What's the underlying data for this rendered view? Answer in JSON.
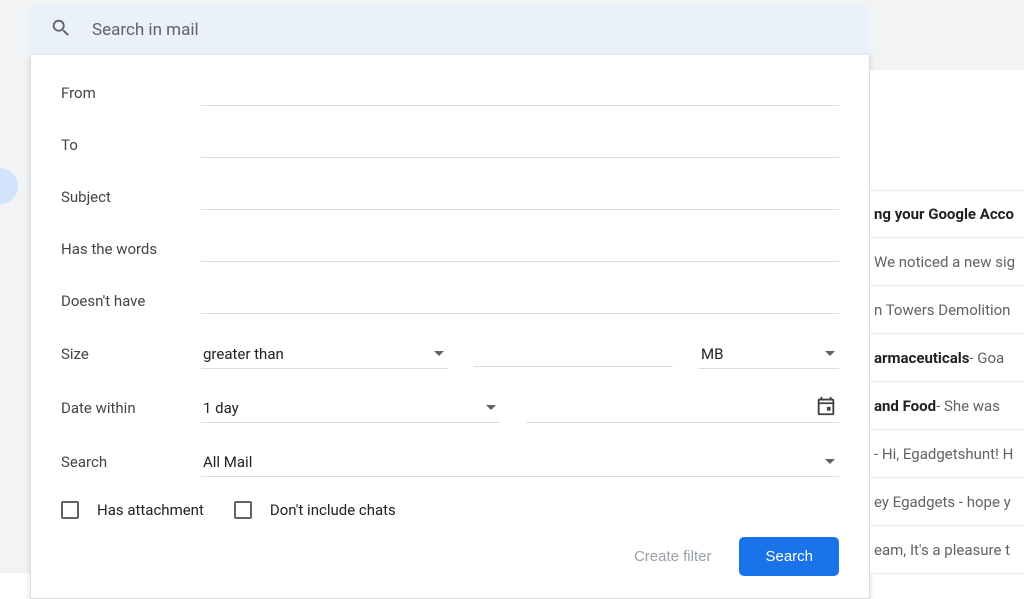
{
  "search": {
    "placeholder": "Search in mail"
  },
  "form": {
    "fromLabel": "From",
    "toLabel": "To",
    "subjectLabel": "Subject",
    "hasWordsLabel": "Has the words",
    "doesntHaveLabel": "Doesn't have",
    "sizeLabel": "Size",
    "sizeComparator": "greater than",
    "sizeUnit": "MB",
    "dateWithinLabel": "Date within",
    "dateRange": "1 day",
    "searchLabel": "Search",
    "searchScope": "All Mail",
    "hasAttachmentLabel": "Has attachment",
    "dontIncludeChatsLabel": "Don't include chats",
    "createFilterButton": "Create filter",
    "searchButton": "Search"
  },
  "mailPreview": {
    "rows": [
      {
        "bold": "ng your Google Acco",
        "grey": ""
      },
      {
        "bold": "",
        "grey": "We noticed a new sig"
      },
      {
        "bold": "",
        "grey": "n Towers Demolition "
      },
      {
        "bold": "armaceuticals",
        "grey": " - Goa"
      },
      {
        "bold": "and Food",
        "grey": " - She was "
      },
      {
        "bold": "",
        "grey": "- Hi, Egadgetshunt! H"
      },
      {
        "bold": "",
        "grey": "ey Egadgets - hope y"
      },
      {
        "bold": "",
        "grey": "eam, It's a pleasure t"
      }
    ]
  }
}
